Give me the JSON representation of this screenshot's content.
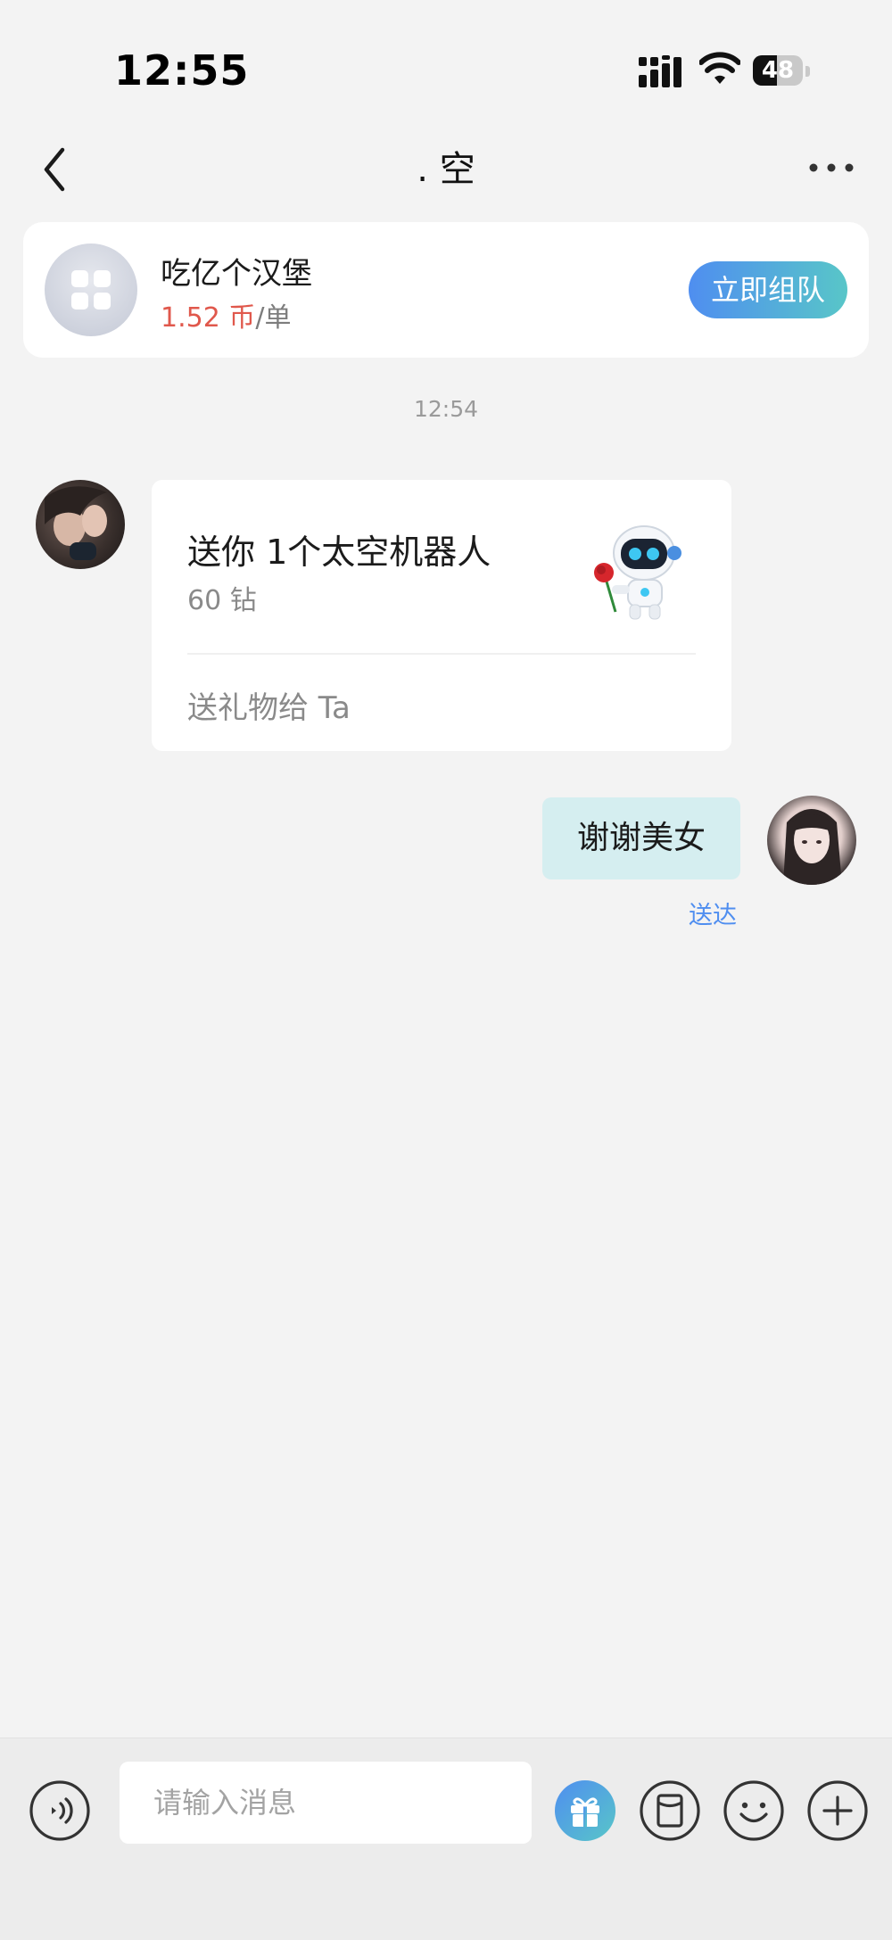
{
  "status_bar": {
    "time": "12:55",
    "battery_level": "48",
    "battery_fraction": 0.48
  },
  "header": {
    "title": ". 空",
    "back_icon": "chevron-left-icon",
    "more_icon": "more-horizontal-icon"
  },
  "team_card": {
    "name": "吃亿个汉堡",
    "price_amount": "1.52 币",
    "price_unit": "/单",
    "join_button": "立即组队",
    "accent_gradient": [
      "#4f8ef0",
      "#58c6c8"
    ],
    "price_color": "#e0584c"
  },
  "chat": {
    "timestamp": "12:54",
    "gift_message": {
      "title": "送你 1个太空机器人",
      "price": "60 钻",
      "action": "送礼物给 Ta",
      "gift_icon": "space-robot-icon"
    },
    "reply_message": {
      "text": "谢谢美女",
      "status": "送达",
      "bubble_color": "#d5eef0"
    }
  },
  "input_bar": {
    "placeholder": "请输入消息",
    "tools": [
      "voice-icon",
      "gift-icon",
      "red-packet-icon",
      "emoji-icon",
      "plus-icon"
    ]
  }
}
